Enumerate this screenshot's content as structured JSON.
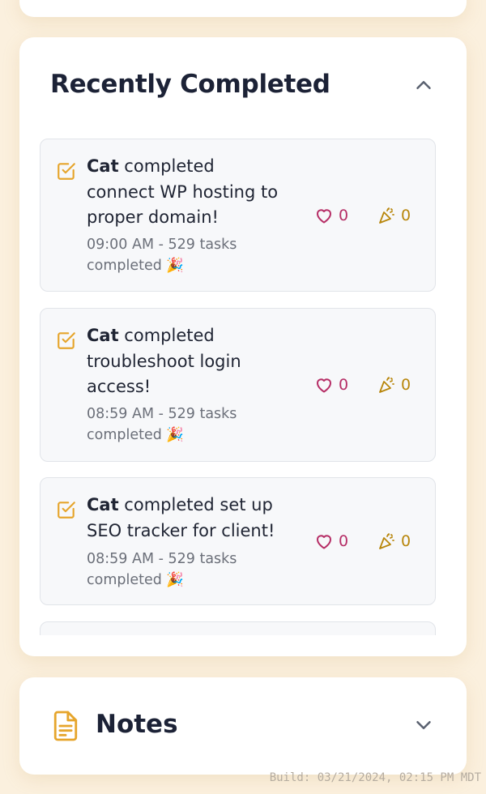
{
  "recent": {
    "title": "Recently Completed",
    "items": [
      {
        "user": "Cat",
        "action": " completed connect WP hosting to proper domain!",
        "meta": "09:00 AM - 529 tasks completed 🎉",
        "hearts": "0",
        "celebrations": "0"
      },
      {
        "user": "Cat",
        "action": " completed troubleshoot login access!",
        "meta": "08:59 AM - 529 tasks completed 🎉",
        "hearts": "0",
        "celebrations": "0"
      },
      {
        "user": "Cat",
        "action": " completed set up SEO tracker for client!",
        "meta": "08:59 AM - 529 tasks completed 🎉",
        "hearts": "0",
        "celebrations": "0"
      }
    ]
  },
  "notes": {
    "title": "Notes"
  },
  "footer": {
    "build": "Build: 03/21/2024, 02:15 PM MDT"
  },
  "icons": {
    "check": "checkbox-check-icon",
    "heart": "heart-icon",
    "party": "party-popper-icon",
    "notes": "document-icon",
    "collapse": "chevron-up-icon",
    "expand": "chevron-down-icon"
  },
  "colors": {
    "background": "#fbf0de",
    "accent": "#e6a52c",
    "heart": "#b62e66",
    "party": "#b8860b",
    "title": "#1c2236"
  }
}
